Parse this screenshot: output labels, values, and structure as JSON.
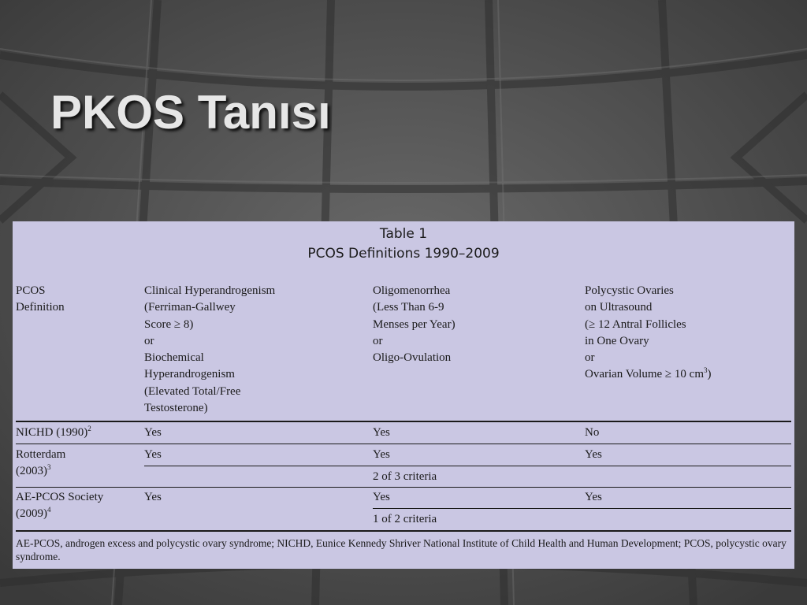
{
  "slide": {
    "title": "PKOS Tanısı"
  },
  "table": {
    "caption_line1": "Table 1",
    "caption_line2": "PCOS Definitions 1990–2009",
    "headers": [
      [
        "PCOS",
        "Definition"
      ],
      [
        "Clinical Hyperandrogenism",
        "(Ferriman-Gallwey",
        "Score ≥ 8)",
        "or",
        "Biochemical",
        "Hyperandrogenism",
        "(Elevated Total/Free",
        "Testosterone)"
      ],
      [
        "Oligomenorrhea",
        "(Less Than 6-9",
        "Menses per Year)",
        "or",
        "Oligo-Ovulation"
      ],
      [
        "Polycystic Ovaries",
        "on Ultrasound",
        "(≥ 12 Antral Follicles",
        "in One Ovary",
        "or",
        "Ovarian Volume ≥ 10 cm",
        "3",
        ")"
      ]
    ],
    "rows": [
      {
        "label": "NICHD (1990)",
        "ref": "2",
        "c1": "Yes",
        "c2": "Yes",
        "c3": "No"
      },
      {
        "label_line1": "Rotterdam",
        "label_line2": "(2003)",
        "ref": "3",
        "c1": "Yes",
        "c2": "Yes",
        "c3": "Yes",
        "criteria": "2 of 3 criteria"
      },
      {
        "label_line1": "AE-PCOS Society",
        "label_line2": "(2009)",
        "ref": "4",
        "c1": "Yes",
        "c2": "Yes",
        "c3": "Yes",
        "criteria": "1 of 2 criteria"
      }
    ],
    "footnote": "AE-PCOS, androgen excess and polycystic ovary syndrome; NICHD, Eunice Kennedy Shriver National Institute of Child Health and Human Development; PCOS, polycystic ovary syndrome."
  },
  "colors": {
    "table_background": "#cac7e3",
    "title_color": "#e6e6e6"
  }
}
